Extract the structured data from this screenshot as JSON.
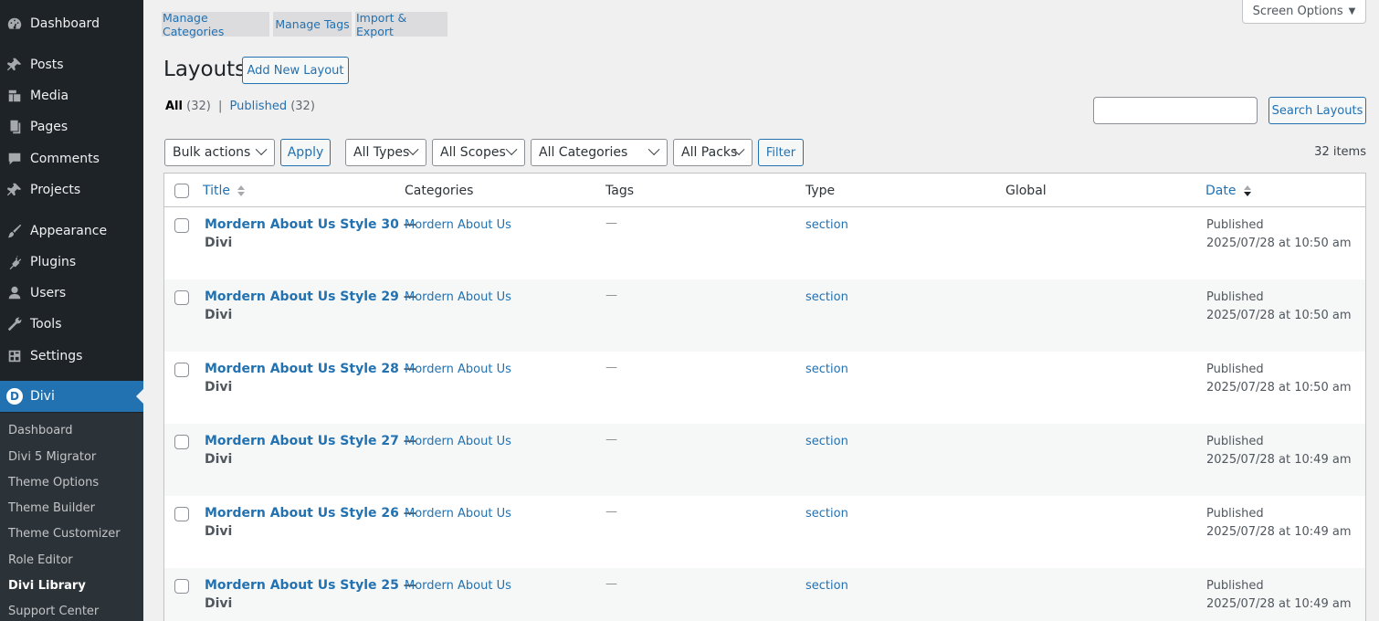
{
  "sidebar": {
    "items": [
      {
        "label": "Dashboard",
        "icon": "dashboard-icon"
      },
      {
        "label": "Posts",
        "icon": "pin-icon"
      },
      {
        "label": "Media",
        "icon": "media-icon"
      },
      {
        "label": "Pages",
        "icon": "pages-icon"
      },
      {
        "label": "Comments",
        "icon": "comment-icon"
      },
      {
        "label": "Projects",
        "icon": "pin-icon"
      },
      {
        "label": "Appearance",
        "icon": "brush-icon"
      },
      {
        "label": "Plugins",
        "icon": "plugin-icon"
      },
      {
        "label": "Users",
        "icon": "user-icon"
      },
      {
        "label": "Tools",
        "icon": "wrench-icon"
      },
      {
        "label": "Settings",
        "icon": "settings-icon"
      },
      {
        "label": "Divi",
        "icon": "divi-logo-icon",
        "logo_letter": "D"
      }
    ],
    "submenu": [
      "Dashboard",
      "Divi 5 Migrator",
      "Theme Options",
      "Theme Builder",
      "Theme Customizer",
      "Role Editor",
      "Divi Library",
      "Support Center"
    ]
  },
  "tabs": [
    "Manage Categories",
    "Manage Tags",
    "Import & Export"
  ],
  "screen_options": "Screen Options",
  "page_title": "Layouts",
  "add_new": "Add New Layout",
  "views": {
    "all": "All",
    "all_count": "(32)",
    "sep": "|",
    "published": "Published",
    "published_count": "(32)"
  },
  "search": {
    "placeholder": "",
    "button": "Search Layouts"
  },
  "filters": {
    "bulk": "Bulk actions",
    "apply": "Apply",
    "types": "All Types",
    "scopes": "All Scopes",
    "categories": "All Categories",
    "packs": "All Packs",
    "filter": "Filter"
  },
  "items_count": "32 items",
  "table": {
    "headers": {
      "title": "Title",
      "categories": "Categories",
      "tags": "Tags",
      "type": "Type",
      "global": "Global",
      "date": "Date"
    },
    "rows": [
      {
        "title": "Mordern About Us Style 30",
        "dash": "—",
        "sub": "Divi",
        "category": "Mordern About Us",
        "tags": "—",
        "type": "section",
        "status": "Published",
        "date": "2025/07/28 at 10:50 am"
      },
      {
        "title": "Mordern About Us Style 29",
        "dash": "—",
        "sub": "Divi",
        "category": "Mordern About Us",
        "tags": "—",
        "type": "section",
        "status": "Published",
        "date": "2025/07/28 at 10:50 am"
      },
      {
        "title": "Mordern About Us Style 28",
        "dash": "—",
        "sub": "Divi",
        "category": "Mordern About Us",
        "tags": "—",
        "type": "section",
        "status": "Published",
        "date": "2025/07/28 at 10:50 am"
      },
      {
        "title": "Mordern About Us Style 27",
        "dash": "—",
        "sub": "Divi",
        "category": "Mordern About Us",
        "tags": "—",
        "type": "section",
        "status": "Published",
        "date": "2025/07/28 at 10:49 am"
      },
      {
        "title": "Mordern About Us Style 26",
        "dash": "—",
        "sub": "Divi",
        "category": "Mordern About Us",
        "tags": "—",
        "type": "section",
        "status": "Published",
        "date": "2025/07/28 at 10:49 am"
      },
      {
        "title": "Mordern About Us Style 25",
        "dash": "—",
        "sub": "Divi",
        "category": "Mordern About Us",
        "tags": "—",
        "type": "section",
        "status": "Published",
        "date": "2025/07/28 at 10:49 am"
      }
    ]
  },
  "colors": {
    "sidebar_bg": "#1d2327",
    "accent": "#2271b1",
    "page_bg": "#f0f0f1"
  }
}
